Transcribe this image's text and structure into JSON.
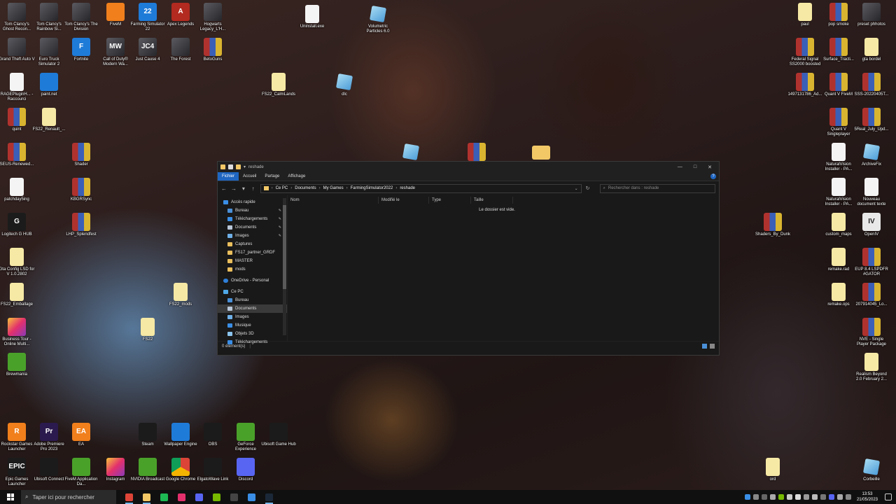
{
  "desktop": {
    "icons": [
      {
        "label": "Tom Clancy's Ghost Recon...",
        "type": "game"
      },
      {
        "label": "Tom Clancy's Rainbow Si...",
        "type": "game"
      },
      {
        "label": "Tom Clancy's The Division",
        "type": "game"
      },
      {
        "label": "FiveM",
        "type": "orange"
      },
      {
        "label": "Farming Simulator 22",
        "type": "blue",
        "glyph": "22"
      },
      {
        "label": "Apex Legends",
        "type": "red",
        "glyph": "A"
      },
      {
        "label": "Hogwarts Legacy_L'H...",
        "type": "game"
      },
      {
        "label": "Uninstall.exe",
        "type": "file"
      },
      {
        "label": "Volumetric Particles 6.0",
        "type": "cube"
      },
      {
        "label": "Grand Theft Auto V",
        "type": "game"
      },
      {
        "label": "Euro Truck Simulator 2",
        "type": "game"
      },
      {
        "label": "Fortnite",
        "type": "blue",
        "glyph": "F"
      },
      {
        "label": "Call of Duty® Modern Wa...",
        "type": "game",
        "glyph": "MW"
      },
      {
        "label": "Just Cause 4",
        "type": "game",
        "glyph": "JC4"
      },
      {
        "label": "The Forest",
        "type": "game"
      },
      {
        "label": "BetoGuns",
        "type": "rar"
      },
      {
        "label": "RAGEPluginH... - Raccourci",
        "type": "file"
      },
      {
        "label": "paint.net",
        "type": "blue"
      },
      {
        "label": "FS22_CalmLands",
        "type": "note"
      },
      {
        "label": "dlc",
        "type": "cube"
      },
      {
        "label": "quint",
        "type": "rar"
      },
      {
        "label": "FS22_Renault_...",
        "type": "note"
      },
      {
        "label": "SEUS-Renewed...",
        "type": "rar"
      },
      {
        "label": "Shader",
        "type": "rar"
      },
      {
        "label": "patchday5ing",
        "type": "file"
      },
      {
        "label": "KBGRSync",
        "type": "rar"
      },
      {
        "label": "Logitech G HUB",
        "type": "dark",
        "glyph": "G"
      },
      {
        "label": "LHP_Splendfest",
        "type": "rar"
      },
      {
        "label": "Gta Config LSD for V 1.0.2802",
        "type": "note"
      },
      {
        "label": "FS22_Emballage",
        "type": "note"
      },
      {
        "label": "FS22_mods",
        "type": "note"
      },
      {
        "label": "Business Tour - Online Multi...",
        "type": "pink"
      },
      {
        "label": "FS22",
        "type": "note"
      },
      {
        "label": "Brewmania",
        "type": "green"
      },
      {
        "label": "Rockstar Games Launcher",
        "type": "orange",
        "glyph": "R"
      },
      {
        "label": "Adobe Premiere Pro 2023",
        "type": "purple",
        "glyph": "Pr"
      },
      {
        "label": "EA",
        "type": "orange",
        "glyph": "EA"
      },
      {
        "label": "Steam",
        "type": "dark"
      },
      {
        "label": "Wallpaper Engine",
        "type": "blue"
      },
      {
        "label": "OBS",
        "type": "dark"
      },
      {
        "label": "GeForce Experience",
        "type": "green"
      },
      {
        "label": "Ubisoft Game Hub",
        "type": "dark"
      },
      {
        "label": "Epic Games Launcher",
        "type": "dark",
        "glyph": "EPIC"
      },
      {
        "label": "Ubisoft Connect",
        "type": "dark"
      },
      {
        "label": "FiveM Application Da...",
        "type": "green"
      },
      {
        "label": "Instagram",
        "type": "pink"
      },
      {
        "label": "NVIDIA Broadcast",
        "type": "green"
      },
      {
        "label": "Google Chrome",
        "type": "chrome"
      },
      {
        "label": "ElgatoWave Link",
        "type": "dark"
      },
      {
        "label": "Discord",
        "type": "discord"
      },
      {
        "label": "paul",
        "type": "note"
      },
      {
        "label": "pop smoke",
        "type": "rar"
      },
      {
        "label": "preset phhotos",
        "type": "game"
      },
      {
        "label": "Federal Signal SS2000 boosted",
        "type": "rar"
      },
      {
        "label": "Surface_Tracti...",
        "type": "rar"
      },
      {
        "label": "gta bordel",
        "type": "note"
      },
      {
        "label": "1497131786_Ad...",
        "type": "rar"
      },
      {
        "label": "Quant V FiveM",
        "type": "rar"
      },
      {
        "label": "SSS-20220405T...",
        "type": "rar"
      },
      {
        "label": "Quant V Singleplayer",
        "type": "rar"
      },
      {
        "label": "5Real_July_Upd...",
        "type": "rar"
      },
      {
        "label": "NaturalVision Installer - PA...",
        "type": "file"
      },
      {
        "label": "ArchiveFix",
        "type": "cube"
      },
      {
        "label": "NaturalVision Installer - PA...",
        "type": "file"
      },
      {
        "label": "Nouveau document texte",
        "type": "file"
      },
      {
        "label": "Shaders_By_Dunk",
        "type": "rar"
      },
      {
        "label": "custom_maps",
        "type": "note"
      },
      {
        "label": "OpenIV",
        "type": "white",
        "glyph": "IV"
      },
      {
        "label": "remake.rad",
        "type": "note"
      },
      {
        "label": "EUP 8.4 LSPDFR #GATOR",
        "type": "rar"
      },
      {
        "label": "remake.ops",
        "type": "note"
      },
      {
        "label": "207914045_Lo...",
        "type": "rar"
      },
      {
        "label": "NVE - Single Player Package",
        "type": "rar"
      },
      {
        "label": "Realism Beyond 2.0 February 2...",
        "type": "note"
      },
      {
        "label": "ord",
        "type": "note"
      },
      {
        "label": "Corbeille",
        "type": "cube"
      },
      {
        "label": "",
        "type": "folder"
      },
      {
        "label": "",
        "type": "rar"
      },
      {
        "label": "",
        "type": "cube"
      }
    ]
  },
  "explorer": {
    "title": "reshade",
    "tabs": [
      "Fichier",
      "Accueil",
      "Partage",
      "Affichage"
    ],
    "window_controls": [
      "—",
      "□",
      "✕"
    ],
    "path": [
      "Ce PC",
      "Documents",
      "My Games",
      "FarmingSimulator2022",
      "reshade"
    ],
    "search_placeholder": "Rechercher dans : reshade",
    "columns": [
      "Nom",
      "Modifié le",
      "Type",
      "Taille"
    ],
    "empty_text": "Le dossier est vide.",
    "status": "0 élément(s)",
    "nav": [
      {
        "label": "Accès rapide",
        "icon": "star",
        "level": 0
      },
      {
        "label": "Bureau",
        "icon": "blue",
        "level": 1,
        "pinned": true
      },
      {
        "label": "Téléchargements",
        "icon": "down",
        "level": 1,
        "pinned": true
      },
      {
        "label": "Documents",
        "icon": "doc",
        "level": 1,
        "pinned": true
      },
      {
        "label": "Images",
        "icon": "img",
        "level": 1,
        "pinned": true
      },
      {
        "label": "Captures",
        "icon": "fold",
        "level": 1
      },
      {
        "label": "FS17_partner_GRDF",
        "icon": "fold",
        "level": 1
      },
      {
        "label": "MASTER",
        "icon": "fold",
        "level": 1
      },
      {
        "label": "mods",
        "icon": "fold",
        "level": 1
      },
      {
        "label": "",
        "icon": "",
        "level": -1
      },
      {
        "label": "OneDrive - Personal",
        "icon": "cloud",
        "level": 0
      },
      {
        "label": "",
        "icon": "",
        "level": -1
      },
      {
        "label": "Ce PC",
        "icon": "pc",
        "level": 0
      },
      {
        "label": "Bureau",
        "icon": "blue",
        "level": 1
      },
      {
        "label": "Documents",
        "icon": "doc",
        "level": 1,
        "selected": true
      },
      {
        "label": "Images",
        "icon": "img",
        "level": 1
      },
      {
        "label": "Musique",
        "icon": "mus",
        "level": 1
      },
      {
        "label": "Objets 3D",
        "icon": "obj",
        "level": 1
      },
      {
        "label": "Téléchargements",
        "icon": "down",
        "level": 1
      }
    ]
  },
  "taskbar": {
    "search_placeholder": "Taper ici pour rechercher",
    "apps": [
      {
        "name": "chrome",
        "color": "#db4437",
        "running": true
      },
      {
        "name": "file-explorer",
        "color": "#f2c867",
        "running": true
      },
      {
        "name": "spotify",
        "color": "#1db954",
        "running": false
      },
      {
        "name": "instagram",
        "color": "#e3306c",
        "running": false
      },
      {
        "name": "steam-chat",
        "color": "#5865f2",
        "running": false
      },
      {
        "name": "nvidia",
        "color": "#76b900",
        "running": false
      },
      {
        "name": "obs",
        "color": "#444444",
        "running": false
      },
      {
        "name": "ubisoft",
        "color": "#3a8ee6",
        "running": false
      },
      {
        "name": "steam",
        "color": "#1b2838",
        "running": true
      }
    ],
    "time": "13:53",
    "date": "21/05/2023"
  }
}
